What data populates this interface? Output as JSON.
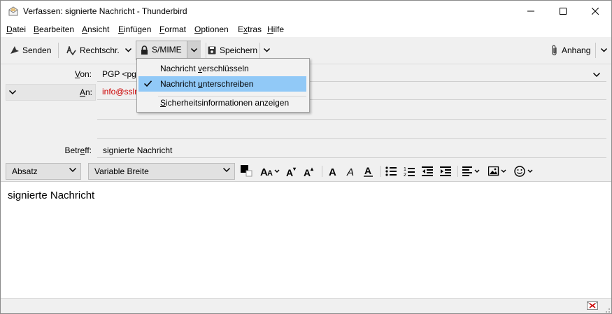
{
  "window": {
    "title": "Verfassen: signierte Nachricht - Thunderbird"
  },
  "menu": {
    "items": [
      {
        "label": "Datei",
        "u": "D",
        "rest": "atei"
      },
      {
        "label": "Bearbeiten",
        "u": "B",
        "rest": "earbeiten"
      },
      {
        "label": "Ansicht",
        "u": "A",
        "rest": "nsicht"
      },
      {
        "label": "Einfügen",
        "u": "E",
        "rest": "infügen"
      },
      {
        "label": "Format",
        "u": "F",
        "rest": "ormat"
      },
      {
        "label": "Optionen",
        "u": "O",
        "rest": "ptionen"
      },
      {
        "label": "Extras",
        "u": "x",
        "pre": "E",
        "rest": "tras"
      },
      {
        "label": "Hilfe",
        "u": "H",
        "rest": "ilfe"
      }
    ]
  },
  "toolbar": {
    "send": "Senden",
    "spelling": "Rechtschr.",
    "smime": "S/MIME",
    "save": "Speichern",
    "attach": "Anhang"
  },
  "headers": {
    "from_label_u": "V",
    "from_label_rest": "on:",
    "from_value": "PGP <pg",
    "to_label_u": "A",
    "to_label_rest": "n:",
    "to_value": "info@sslr",
    "subject_label_pre": "Betr",
    "subject_label_u": "e",
    "subject_label_rest": "ff:",
    "subject_value": "signierte Nachricht"
  },
  "format": {
    "paragraph": "Absatz",
    "font": "Variable Breite"
  },
  "body": {
    "text": "signierte Nachricht"
  },
  "popup": {
    "encrypt": {
      "pre": "Nachricht ",
      "u": "v",
      "rest": "erschlüsseln"
    },
    "sign": {
      "pre": "Nachricht ",
      "u": "u",
      "rest": "nterschreiben",
      "checked": true
    },
    "info": {
      "pre": "",
      "u": "S",
      "rest": "icherheitsinformationen anzeigen"
    }
  },
  "colors": {
    "highlight": "#91c9f7",
    "to_value": "#cc0000"
  }
}
